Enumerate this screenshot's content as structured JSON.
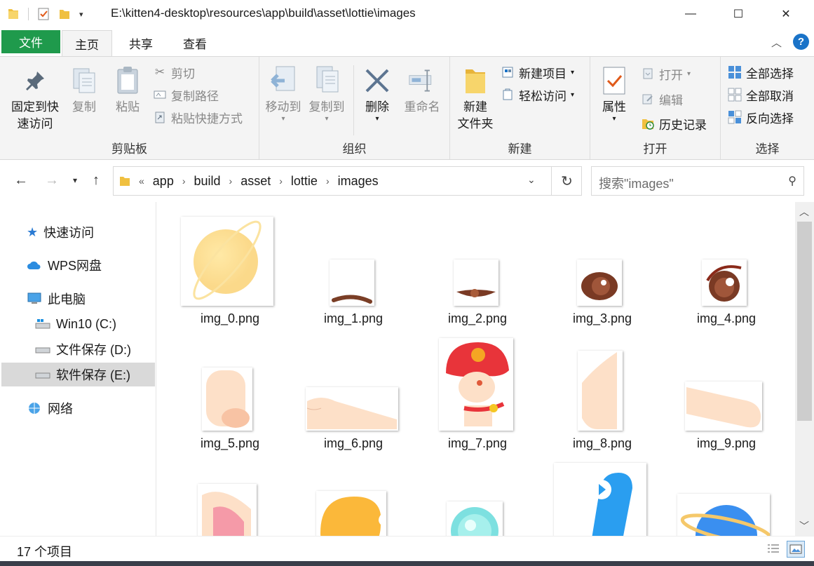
{
  "window": {
    "title": "E:\\kitten4-desktop\\resources\\app\\build\\asset\\lottie\\images",
    "minimize": "—",
    "maximize": "☐",
    "close": "✕"
  },
  "tabs": {
    "file": "文件",
    "home": "主页",
    "share": "共享",
    "view": "查看"
  },
  "ribbon": {
    "clipboard": {
      "label": "剪贴板",
      "pin_line1": "固定到快",
      "pin_line2": "速访问",
      "copy": "复制",
      "paste": "粘贴",
      "cut": "剪切",
      "copy_path": "复制路径",
      "paste_shortcut": "粘贴快捷方式"
    },
    "organize": {
      "label": "组织",
      "move_to": "移动到",
      "copy_to": "复制到",
      "delete": "删除",
      "rename": "重命名"
    },
    "new": {
      "label": "新建",
      "new_folder_line1": "新建",
      "new_folder_line2": "文件夹",
      "new_item": "新建项目",
      "easy_access": "轻松访问"
    },
    "open": {
      "label": "打开",
      "properties": "属性",
      "open": "打开",
      "edit": "编辑",
      "history": "历史记录"
    },
    "select": {
      "label": "选择",
      "select_all": "全部选择",
      "select_none": "全部取消",
      "invert": "反向选择"
    }
  },
  "address": {
    "overflow": "«",
    "crumbs": [
      "app",
      "build",
      "asset",
      "lottie",
      "images"
    ]
  },
  "search": {
    "placeholder": "搜索\"images\""
  },
  "nav": {
    "quick_access": "快速访问",
    "wps": "WPS网盘",
    "this_pc": "此电脑",
    "drive_c": "Win10 (C:)",
    "drive_d": "文件保存 (D:)",
    "drive_e": "软件保存 (E:)",
    "network": "网络"
  },
  "files": [
    "img_0.png",
    "img_1.png",
    "img_2.png",
    "img_3.png",
    "img_4.png",
    "img_5.png",
    "img_6.png",
    "img_7.png",
    "img_8.png",
    "img_9.png"
  ],
  "status": {
    "count": "17 个项目"
  },
  "colors": {
    "file_tab": "#1f9a4c",
    "accent": "#1a73c8",
    "selection": "#d9d9d9"
  }
}
